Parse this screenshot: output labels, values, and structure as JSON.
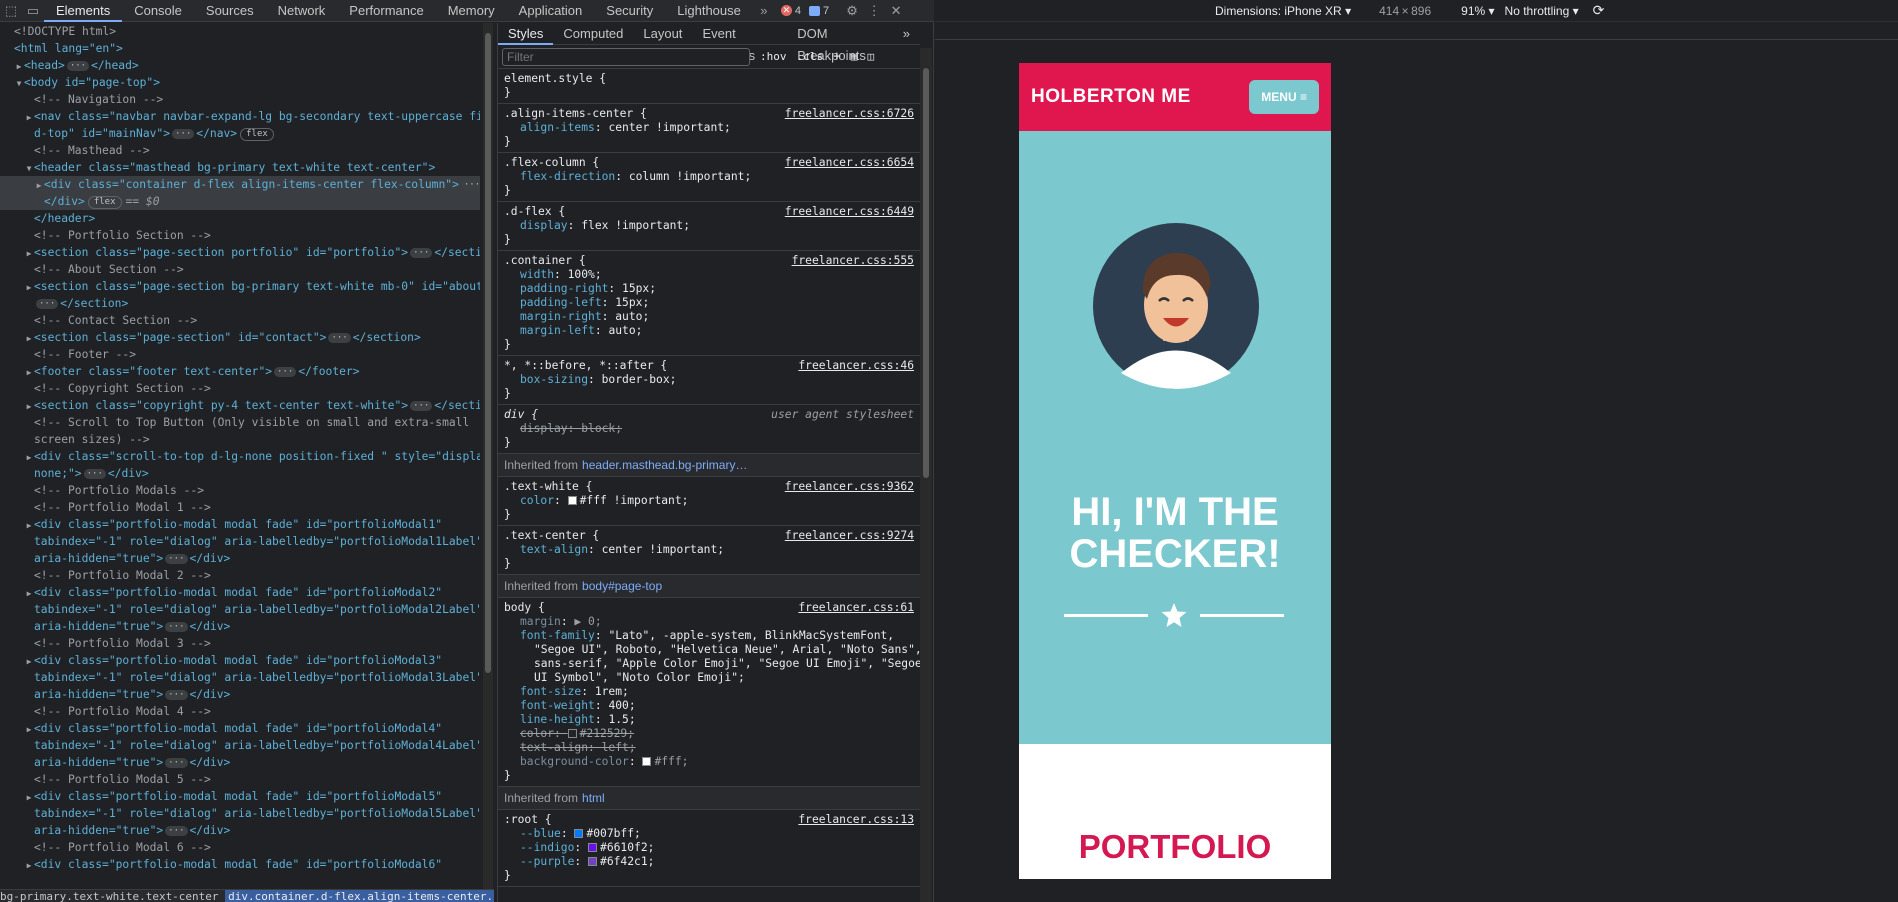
{
  "toolbar": {
    "tabs": [
      "Elements",
      "Console",
      "Sources",
      "Network",
      "Performance",
      "Memory",
      "Application",
      "Security",
      "Lighthouse"
    ],
    "errors": "4",
    "messages": "7"
  },
  "elements": {
    "lines": [
      {
        "i": 0,
        "t": "",
        "h": "<!DOCTYPE html>",
        "k": "cm"
      },
      {
        "i": 0,
        "t": "",
        "h": "<html lang=\"en\">",
        "k": "tag"
      },
      {
        "i": 1,
        "t": "▶",
        "h": "<head>",
        "k": "tag",
        "d": true,
        "e": "</head>"
      },
      {
        "i": 1,
        "t": "▼",
        "h": "<body id=\"page-top\">",
        "k": "tag"
      },
      {
        "i": 2,
        "t": "",
        "h": "<!-- Navigation -->",
        "k": "cm"
      },
      {
        "i": 2,
        "t": "▶",
        "h": "<nav class=\"navbar navbar-expand-lg bg-secondary text-uppercase fixe",
        "k": "tag"
      },
      {
        "i": 2,
        "t": "",
        "h": "d-top\" id=\"mainNav\">",
        "k": "tag",
        "d": true,
        "e": "</nav>",
        "p": "flex"
      },
      {
        "i": 2,
        "t": "",
        "h": "<!-- Masthead -->",
        "k": "cm"
      },
      {
        "i": 2,
        "t": "▼",
        "h": "<header class=\"masthead bg-primary text-white text-center\">",
        "k": "tag"
      },
      {
        "i": 3,
        "t": "▶",
        "h": "<div class=\"container d-flex align-items-center flex-column\">",
        "k": "tag",
        "d": true,
        "sel": true
      },
      {
        "i": 3,
        "t": "",
        "h": "</div>",
        "k": "tag",
        "p": "flex",
        "z": "== $0",
        "sel": true
      },
      {
        "i": 2,
        "t": "",
        "h": "</header>",
        "k": "tag"
      },
      {
        "i": 2,
        "t": "",
        "h": "<!-- Portfolio Section -->",
        "k": "cm"
      },
      {
        "i": 2,
        "t": "▶",
        "h": "<section class=\"page-section portfolio\" id=\"portfolio\">",
        "k": "tag",
        "d": true,
        "e": "</section>"
      },
      {
        "i": 2,
        "t": "",
        "h": "<!-- About Section -->",
        "k": "cm"
      },
      {
        "i": 2,
        "t": "▶",
        "h": "<section class=\"page-section bg-primary text-white mb-0\" id=\"about\">",
        "k": "tag"
      },
      {
        "i": 2,
        "t": "",
        "h": "",
        "k": "tag",
        "d": true,
        "e": "</section>"
      },
      {
        "i": 2,
        "t": "",
        "h": "<!-- Contact Section -->",
        "k": "cm"
      },
      {
        "i": 2,
        "t": "▶",
        "h": "<section class=\"page-section\" id=\"contact\">",
        "k": "tag",
        "d": true,
        "e": "</section>"
      },
      {
        "i": 2,
        "t": "",
        "h": "<!-- Footer -->",
        "k": "cm"
      },
      {
        "i": 2,
        "t": "▶",
        "h": "<footer class=\"footer text-center\">",
        "k": "tag",
        "d": true,
        "e": "</footer>"
      },
      {
        "i": 2,
        "t": "",
        "h": "<!-- Copyright Section -->",
        "k": "cm"
      },
      {
        "i": 2,
        "t": "▶",
        "h": "<section class=\"copyright py-4 text-center text-white\">",
        "k": "tag",
        "d": true,
        "e": "</section>"
      },
      {
        "i": 2,
        "t": "",
        "h": "<!-- Scroll to Top Button (Only visible on small and extra-small",
        "k": "cm"
      },
      {
        "i": 2,
        "t": "",
        "h": "screen sizes) -->",
        "k": "cm"
      },
      {
        "i": 2,
        "t": "▶",
        "h": "<div class=\"scroll-to-top d-lg-none position-fixed \" style=\"display:",
        "k": "tag"
      },
      {
        "i": 2,
        "t": "",
        "h": "none;\">",
        "k": "tag",
        "d": true,
        "e": "</div>"
      },
      {
        "i": 2,
        "t": "",
        "h": "<!-- Portfolio Modals -->",
        "k": "cm"
      },
      {
        "i": 2,
        "t": "",
        "h": "<!-- Portfolio Modal 1 -->",
        "k": "cm"
      },
      {
        "i": 2,
        "t": "▶",
        "h": "<div class=\"portfolio-modal modal fade\" id=\"portfolioModal1\"",
        "k": "tag"
      },
      {
        "i": 2,
        "t": "",
        "h": "tabindex=\"-1\" role=\"dialog\" aria-labelledby=\"portfolioModal1Label\"",
        "k": "tag"
      },
      {
        "i": 2,
        "t": "",
        "h": "aria-hidden=\"true\">",
        "k": "tag",
        "d": true,
        "e": "</div>"
      },
      {
        "i": 2,
        "t": "",
        "h": "<!-- Portfolio Modal 2 -->",
        "k": "cm"
      },
      {
        "i": 2,
        "t": "▶",
        "h": "<div class=\"portfolio-modal modal fade\" id=\"portfolioModal2\"",
        "k": "tag"
      },
      {
        "i": 2,
        "t": "",
        "h": "tabindex=\"-1\" role=\"dialog\" aria-labelledby=\"portfolioModal2Label\"",
        "k": "tag"
      },
      {
        "i": 2,
        "t": "",
        "h": "aria-hidden=\"true\">",
        "k": "tag",
        "d": true,
        "e": "</div>"
      },
      {
        "i": 2,
        "t": "",
        "h": "<!-- Portfolio Modal 3 -->",
        "k": "cm"
      },
      {
        "i": 2,
        "t": "▶",
        "h": "<div class=\"portfolio-modal modal fade\" id=\"portfolioModal3\"",
        "k": "tag"
      },
      {
        "i": 2,
        "t": "",
        "h": "tabindex=\"-1\" role=\"dialog\" aria-labelledby=\"portfolioModal3Label\"",
        "k": "tag"
      },
      {
        "i": 2,
        "t": "",
        "h": "aria-hidden=\"true\">",
        "k": "tag",
        "d": true,
        "e": "</div>"
      },
      {
        "i": 2,
        "t": "",
        "h": "<!-- Portfolio Modal 4 -->",
        "k": "cm"
      },
      {
        "i": 2,
        "t": "▶",
        "h": "<div class=\"portfolio-modal modal fade\" id=\"portfolioModal4\"",
        "k": "tag"
      },
      {
        "i": 2,
        "t": "",
        "h": "tabindex=\"-1\" role=\"dialog\" aria-labelledby=\"portfolioModal4Label\"",
        "k": "tag"
      },
      {
        "i": 2,
        "t": "",
        "h": "aria-hidden=\"true\">",
        "k": "tag",
        "d": true,
        "e": "</div>"
      },
      {
        "i": 2,
        "t": "",
        "h": "<!-- Portfolio Modal 5 -->",
        "k": "cm"
      },
      {
        "i": 2,
        "t": "▶",
        "h": "<div class=\"portfolio-modal modal fade\" id=\"portfolioModal5\"",
        "k": "tag"
      },
      {
        "i": 2,
        "t": "",
        "h": "tabindex=\"-1\" role=\"dialog\" aria-labelledby=\"portfolioModal5Label\"",
        "k": "tag"
      },
      {
        "i": 2,
        "t": "",
        "h": "aria-hidden=\"true\">",
        "k": "tag",
        "d": true,
        "e": "</div>"
      },
      {
        "i": 2,
        "t": "",
        "h": "<!-- Portfolio Modal 6 -->",
        "k": "cm"
      },
      {
        "i": 2,
        "t": "▶",
        "h": "<div class=\"portfolio-modal modal fade\" id=\"portfolioModal6\"",
        "k": "tag"
      }
    ]
  },
  "breadcrumbs": [
    "bg-primary.text-white.text-center",
    "div.container.d-flex.align-items-center.flex-column"
  ],
  "styles": {
    "tabs": [
      "Styles",
      "Computed",
      "Layout",
      "Event Listeners",
      "DOM Breakpoints"
    ],
    "filter_placeholder": "Filter",
    "hov": ":hov",
    "cls": ".cls",
    "blocks": [
      {
        "type": "rule",
        "sel": "element.style {",
        "src": "",
        "decls": []
      },
      {
        "type": "rule",
        "sel": ".align-items-center {",
        "src": "freelancer.css:6726",
        "decls": [
          {
            "n": "align-items",
            "v": "center !important;"
          }
        ]
      },
      {
        "type": "rule",
        "sel": ".flex-column {",
        "src": "freelancer.css:6654",
        "decls": [
          {
            "n": "flex-direction",
            "v": "column !important;"
          }
        ]
      },
      {
        "type": "rule",
        "sel": ".d-flex {",
        "src": "freelancer.css:6449",
        "decls": [
          {
            "n": "display",
            "v": "flex !important;"
          }
        ]
      },
      {
        "type": "rule",
        "sel": ".container {",
        "src": "freelancer.css:555",
        "decls": [
          {
            "n": "width",
            "v": "100%;"
          },
          {
            "n": "padding-right",
            "v": "15px;"
          },
          {
            "n": "padding-left",
            "v": "15px;"
          },
          {
            "n": "margin-right",
            "v": "auto;"
          },
          {
            "n": "margin-left",
            "v": "auto;"
          }
        ]
      },
      {
        "type": "rule",
        "sel": "*, *::before, *::after {",
        "src": "freelancer.css:46",
        "decls": [
          {
            "n": "box-sizing",
            "v": "border-box;"
          }
        ]
      },
      {
        "type": "ua",
        "sel": "div {",
        "src": "user agent stylesheet",
        "decls": [
          {
            "n": "display",
            "v": "block;",
            "s": true
          }
        ]
      },
      {
        "type": "inh",
        "label": "Inherited from",
        "from": "header.masthead.bg-primary…"
      },
      {
        "type": "rule",
        "sel": ".text-white {",
        "src": "freelancer.css:9362",
        "decls": [
          {
            "n": "color",
            "v": "#fff !important;",
            "sw": "#ffffff"
          }
        ]
      },
      {
        "type": "rule",
        "sel": ".text-center {",
        "src": "freelancer.css:9274",
        "decls": [
          {
            "n": "text-align",
            "v": "center !important;"
          }
        ]
      },
      {
        "type": "inh",
        "label": "Inherited from",
        "from": "body#page-top"
      },
      {
        "type": "rule",
        "sel": "body {",
        "src": "freelancer.css:61",
        "decls": [
          {
            "n": "margin",
            "v": "▶ 0;",
            "dim": true
          },
          {
            "n": "font-family",
            "v": "\"Lato\", -apple-system, BlinkMacSystemFont,"
          },
          {
            "n": "",
            "v": "\"Segoe UI\", Roboto, \"Helvetica Neue\", Arial, \"Noto Sans\","
          },
          {
            "n": "",
            "v": "sans-serif, \"Apple Color Emoji\", \"Segoe UI Emoji\", \"Segoe"
          },
          {
            "n": "",
            "v": "UI Symbol\", \"Noto Color Emoji\";"
          },
          {
            "n": "font-size",
            "v": "1rem;"
          },
          {
            "n": "font-weight",
            "v": "400;"
          },
          {
            "n": "line-height",
            "v": "1.5;"
          },
          {
            "n": "color",
            "v": "#212529;",
            "s": true,
            "sw": "#212529"
          },
          {
            "n": "text-align",
            "v": "left;",
            "s": true
          },
          {
            "n": "background-color",
            "v": "#fff;",
            "dim": true,
            "sw": "#ffffff"
          }
        ]
      },
      {
        "type": "inh",
        "label": "Inherited from",
        "from": "html"
      },
      {
        "type": "rule",
        "sel": ":root {",
        "src": "freelancer.css:13",
        "decls": [
          {
            "n": "--blue",
            "v": "#007bff;",
            "sw": "#007bff"
          },
          {
            "n": "--indigo",
            "v": "#6610f2;",
            "sw": "#6610f2"
          },
          {
            "n": "--purple",
            "v": "#6f42c1;",
            "sw": "#6f42c1"
          }
        ]
      }
    ]
  },
  "emulation": {
    "dimensions_label": "Dimensions: iPhone XR",
    "width": "414",
    "height": "896",
    "zoom": "91%",
    "throttle": "No throttling"
  },
  "site": {
    "brand": "HOLBERTON ME",
    "menu": "MENU",
    "hero_line1": "HI, I'M THE",
    "hero_line2": "CHECKER!",
    "portfolio": "PORTFOLIO",
    "colors": {
      "primary": "#7cc8cf",
      "secondary": "#e0164f"
    }
  }
}
